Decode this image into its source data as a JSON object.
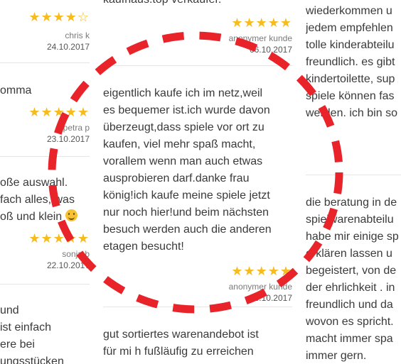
{
  "left_column": {
    "reviews": [
      {
        "stars": "★★★★☆",
        "author": "chris k",
        "date": "24.10.2017"
      },
      {
        "text_lines": [
          "omma"
        ],
        "stars": "★★★★★",
        "author": "petra p",
        "date": "23.10.2017"
      },
      {
        "text_lines": [
          "oße auswahl.",
          "fach alles, was",
          "oß und klein"
        ],
        "stars": "★★★★★",
        "author": "sonja b",
        "date": "22.10.2017"
      },
      {
        "text_lines": [
          "und",
          "ist einfach",
          "ere bei",
          "ungsstücken"
        ]
      }
    ]
  },
  "middle_column": {
    "top_partial_text": "kaufhaus.top verkäufer.",
    "reviews": [
      {
        "stars": "★★★★★",
        "author": "anonymer kunde",
        "date": "06.10.2017"
      },
      {
        "text_lines": [
          "eigentlich kaufe ich im netz,weil",
          "es bequemer ist.ich wurde davon",
          "überzeugt,dass spiele vor ort zu",
          "kaufen, viel mehr spaß macht,",
          "vorallem wenn man auch etwas",
          "ausprobieren darf.danke frau",
          "könig!ich kaufe meine spiele jetzt",
          "nur noch hier!und beim nächsten",
          "besuch werden auch die anderen",
          "etagen besucht!"
        ],
        "stars": "★★★★★",
        "author": "anonymer kunde",
        "date": "06.10.2017"
      },
      {
        "text_lines": [
          "gut sortiertes warenandebot ist",
          "für mi h fußläufig zu erreichen"
        ]
      }
    ]
  },
  "right_column": {
    "reviews": [
      {
        "text_lines": [
          "wiederkommen u",
          "jedem empfehlen",
          "tolle kinderabteilu",
          "freundlich. es gibt",
          "kindertoilette, sup",
          "spiele können fas",
          "werden. ich bin so"
        ]
      },
      {
        "text_lines": [
          "die beratung in de",
          "spielwarenabteilu",
          "habe mir einige sp",
          "erklären lassen u",
          "begeistert, von de",
          "der ehrlichkeit . in",
          "freundlich und da",
          "wovon es spricht.",
          "macht immer spa",
          "immer gern."
        ]
      }
    ]
  },
  "colors": {
    "star": "#f5bb1f",
    "annotation": "#e8232a",
    "divider": "#e6e6e6"
  }
}
